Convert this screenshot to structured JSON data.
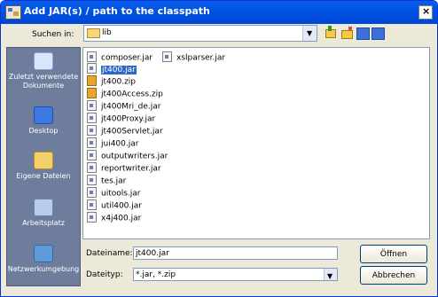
{
  "dialog": {
    "title": "Add JAR(s) / path to the classpath",
    "close_glyph": "×"
  },
  "lookin": {
    "label": "Suchen in:",
    "value": "lib",
    "arrow": "▼"
  },
  "toolbar": {
    "icons": [
      "up-folder-icon",
      "new-folder-icon",
      "list-view-icon",
      "details-view-icon"
    ]
  },
  "places": [
    {
      "label": "Zuletzt verwendete Dokumente",
      "icon": "recent-documents-icon"
    },
    {
      "label": "Desktop",
      "icon": "desktop-icon"
    },
    {
      "label": "Eigene Dateien",
      "icon": "my-documents-icon"
    },
    {
      "label": "Arbeitsplatz",
      "icon": "my-computer-icon"
    },
    {
      "label": "Netzwerkumgebung",
      "icon": "network-icon"
    }
  ],
  "files": [
    {
      "name": "composer.jar",
      "type": "jar"
    },
    {
      "name": "jt400.jar",
      "type": "jar",
      "selected": true
    },
    {
      "name": "jt400.zip",
      "type": "zip"
    },
    {
      "name": "jt400Access.zip",
      "type": "zip"
    },
    {
      "name": "jt400Mri_de.jar",
      "type": "jar"
    },
    {
      "name": "jt400Proxy.jar",
      "type": "jar"
    },
    {
      "name": "jt400Servlet.jar",
      "type": "jar"
    },
    {
      "name": "jui400.jar",
      "type": "jar"
    },
    {
      "name": "outputwriters.jar",
      "type": "jar"
    },
    {
      "name": "reportwriter.jar",
      "type": "jar"
    },
    {
      "name": "tes.jar",
      "type": "jar"
    },
    {
      "name": "uitools.jar",
      "type": "jar"
    },
    {
      "name": "util400.jar",
      "type": "jar"
    },
    {
      "name": "x4j400.jar",
      "type": "jar"
    },
    {
      "name": "xslparser.jar",
      "type": "jar"
    }
  ],
  "filename": {
    "label": "Dateiname:",
    "value": "jt400.jar"
  },
  "filetype": {
    "label": "Dateityp:",
    "value": "*.jar, *.zip",
    "arrow": "▼"
  },
  "buttons": {
    "open": "Öffnen",
    "cancel": "Abbrechen"
  }
}
